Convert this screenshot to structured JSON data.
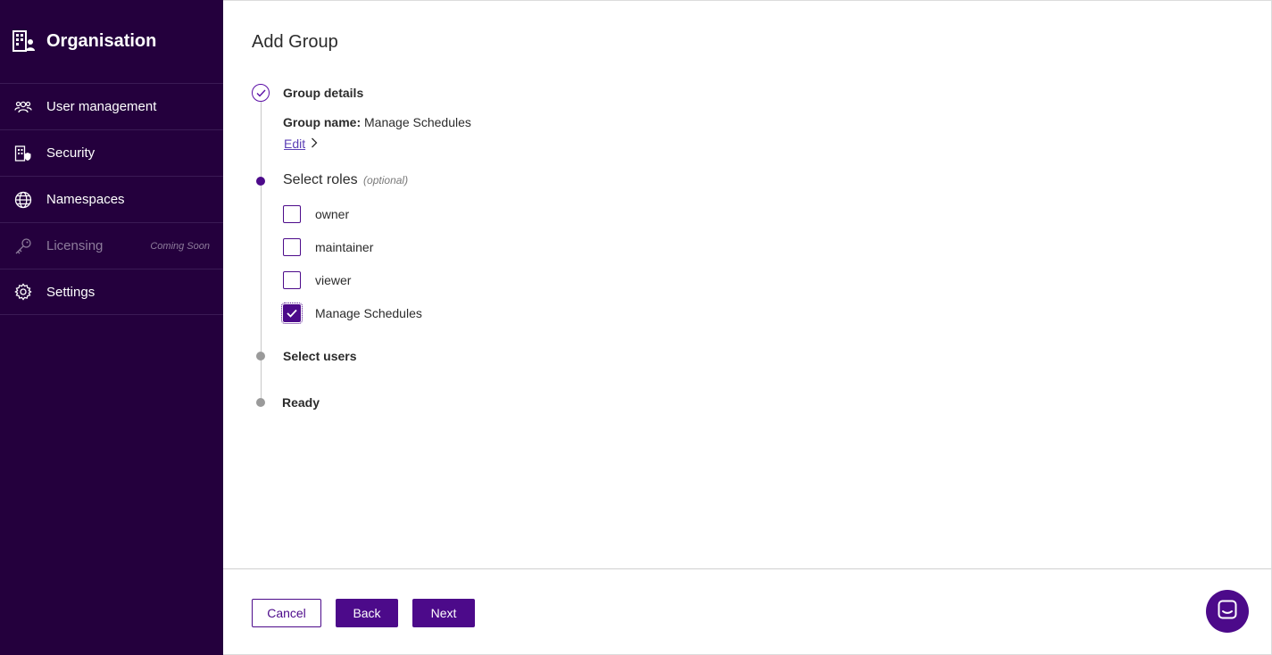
{
  "sidebar": {
    "title": "Organisation",
    "items": [
      {
        "label": "User management",
        "icon": "users-icon"
      },
      {
        "label": "Security",
        "icon": "security-building-icon"
      },
      {
        "label": "Namespaces",
        "icon": "globe-icon"
      },
      {
        "label": "Licensing",
        "icon": "key-icon",
        "badge": "Coming Soon",
        "disabled": true
      },
      {
        "label": "Settings",
        "icon": "gear-icon"
      }
    ]
  },
  "main": {
    "title": "Add Group",
    "steps": {
      "group_details": {
        "label": "Group details",
        "name_label": "Group name:",
        "name_value": "Manage Schedules",
        "edit_label": "Edit"
      },
      "select_roles": {
        "label": "Select roles",
        "optional": "(optional)",
        "roles": [
          {
            "label": "owner",
            "checked": false
          },
          {
            "label": "maintainer",
            "checked": false
          },
          {
            "label": "viewer",
            "checked": false
          },
          {
            "label": "Manage Schedules",
            "checked": true
          }
        ]
      },
      "select_users": {
        "label": "Select users"
      },
      "ready": {
        "label": "Ready"
      }
    }
  },
  "footer": {
    "cancel_label": "Cancel",
    "back_label": "Back",
    "next_label": "Next"
  },
  "colors": {
    "sidebar_bg": "#24003d",
    "accent": "#4c0a8a",
    "link": "#5b3fb5"
  }
}
